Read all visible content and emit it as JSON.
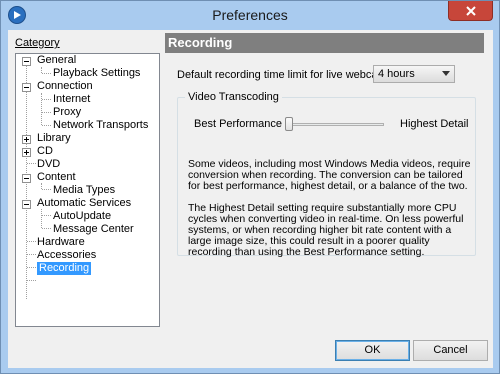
{
  "window": {
    "title": "Preferences"
  },
  "sidebar": {
    "label": "Category",
    "items": [
      {
        "label": "General",
        "expander": "minus"
      },
      {
        "label": "Playback Settings"
      },
      {
        "label": "Connection",
        "expander": "minus"
      },
      {
        "label": "Internet"
      },
      {
        "label": "Proxy"
      },
      {
        "label": "Network Transports"
      },
      {
        "label": "Library",
        "expander": "plus"
      },
      {
        "label": "CD",
        "expander": "plus"
      },
      {
        "label": "DVD"
      },
      {
        "label": "Content",
        "expander": "minus"
      },
      {
        "label": "Media Types"
      },
      {
        "label": "Automatic Services",
        "expander": "minus"
      },
      {
        "label": "AutoUpdate"
      },
      {
        "label": "Message Center"
      },
      {
        "label": "Hardware"
      },
      {
        "label": "Accessories"
      },
      {
        "label": "Recording",
        "selected": true
      }
    ]
  },
  "panel": {
    "title": "Recording",
    "time_limit_label": "Default recording time limit for live webcasts:",
    "time_limit_value": "4 hours",
    "group_label": "Video Transcoding",
    "slider": {
      "left_label": "Best Performance",
      "right_label": "Highest Detail",
      "value_fraction": 0.0
    },
    "para1": "Some videos, including most Windows Media videos, require conversion when recording.  The conversion can be tailored for best performance, highest detail, or a balance of the two.",
    "para2": "The Highest Detail setting require substantially more CPU cycles when converting video in real-time.  On less powerful systems, or when recording higher bit rate content with a large image size, this could result in a poorer quality recording than using the Best Performance setting."
  },
  "buttons": {
    "ok": "OK",
    "cancel": "Cancel"
  },
  "colors": {
    "selection": "#3399ff",
    "header": "#7f7f7f",
    "close": "#c7463a",
    "frame": "#a9cbef"
  }
}
